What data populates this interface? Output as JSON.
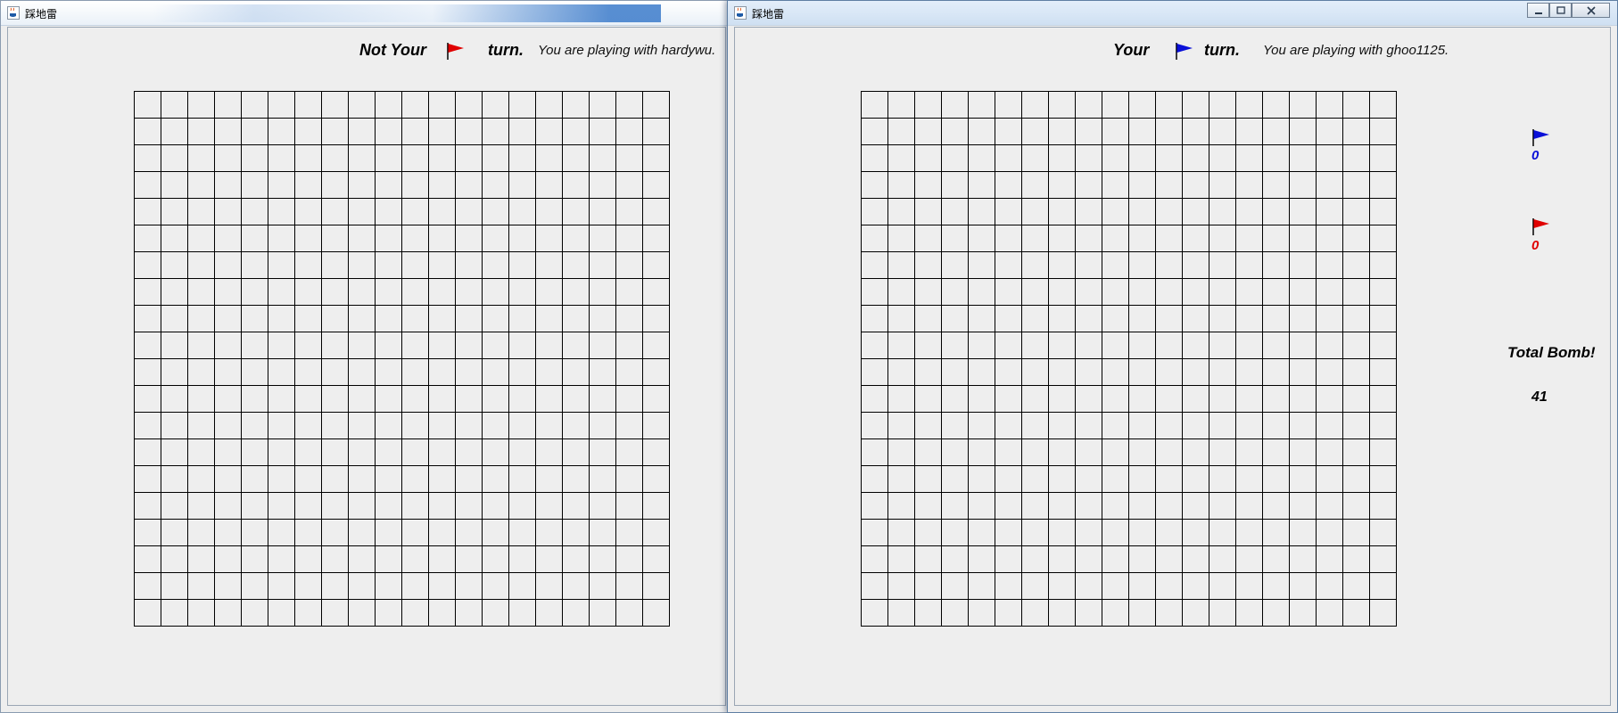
{
  "left_window": {
    "title": "踩地雷",
    "status": {
      "turn_prefix": "Not Your",
      "turn_suffix": "turn.",
      "flag_color": "#e00000",
      "opponent_text": "You are playing with hardywu."
    },
    "grid": {
      "rows": 20,
      "cols": 20
    }
  },
  "right_window": {
    "title": "踩地雷",
    "status": {
      "turn_prefix": "Your",
      "turn_suffix": "turn.",
      "flag_color": "#0a10d8",
      "opponent_text": "You are playing with ghoo1125."
    },
    "grid": {
      "rows": 20,
      "cols": 20
    },
    "buttons": {
      "minimize": "minimize",
      "maximize": "maximize",
      "close": "close"
    },
    "scoreboard": {
      "blue": {
        "flag_color": "#0a10d8",
        "count": "0"
      },
      "red": {
        "flag_color": "#e00000",
        "count": "0"
      },
      "total_label": "Total Bomb!",
      "total_value": "41"
    }
  },
  "icons": {
    "app": "java-cup-icon",
    "flag": "flag-icon"
  }
}
